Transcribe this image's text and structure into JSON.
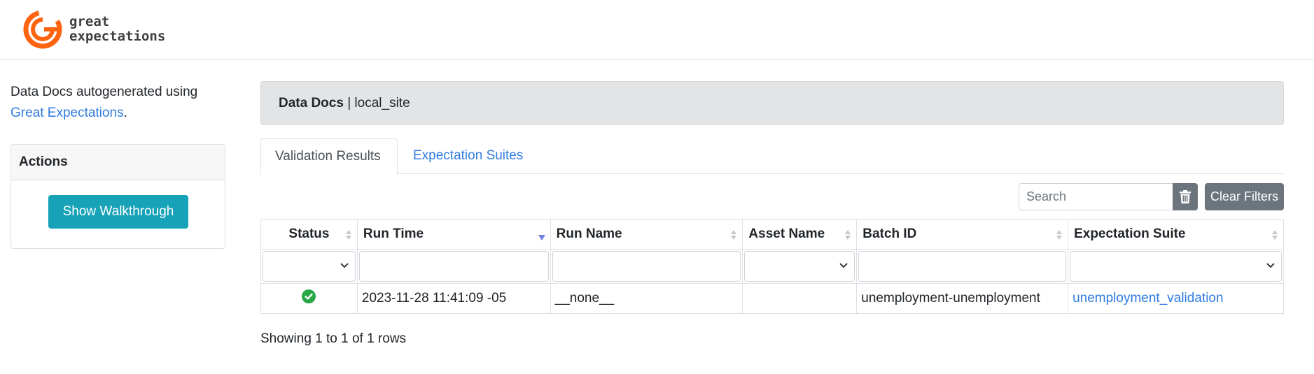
{
  "header": {
    "logo_line1": "great",
    "logo_line2": "expectations"
  },
  "sidebar": {
    "intro_text": "Data Docs autogenerated using",
    "intro_link": "Great Expectations",
    "intro_period": ".",
    "actions_title": "Actions",
    "walkthrough_button": "Show Walkthrough"
  },
  "breadcrumb": {
    "title": "Data Docs",
    "separator": " | ",
    "site": "local_site"
  },
  "tabs": [
    {
      "label": "Validation Results",
      "active": true
    },
    {
      "label": "Expectation Suites",
      "active": false
    }
  ],
  "toolbar": {
    "search_placeholder": "Search",
    "clear_filters": "Clear Filters"
  },
  "table": {
    "columns": [
      "Status",
      "Run Time",
      "Run Name",
      "Asset Name",
      "Batch ID",
      "Expectation Suite"
    ],
    "rows": [
      {
        "status": "success",
        "run_time": "2023-11-28 11:41:09 -05",
        "run_name": "__none__",
        "asset_name": "",
        "batch_id": "unemployment-unemployment",
        "expectation_suite": "unemployment_validation"
      }
    ]
  },
  "pagination": {
    "summary": "Showing 1 to 1 of 1 rows"
  },
  "colors": {
    "brand_orange": "#ff6310",
    "link": "#2f7be0",
    "button_teal": "#17a2b8",
    "button_gray": "#6c757d",
    "success_green": "#28a745"
  }
}
